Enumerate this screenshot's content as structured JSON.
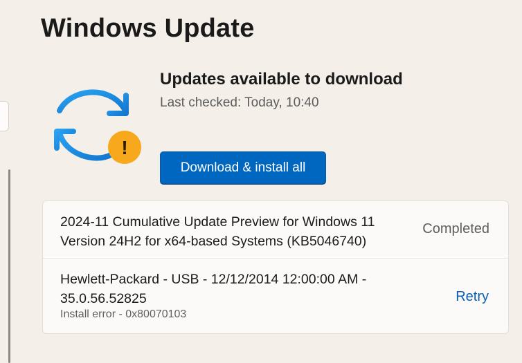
{
  "page": {
    "title": "Windows Update"
  },
  "status": {
    "title": "Updates available to download",
    "last_checked": "Last checked: Today, 10:40",
    "icon": "sync-warning-icon",
    "warning_glyph": "!"
  },
  "actions": {
    "download_install_all": "Download & install all"
  },
  "updates": [
    {
      "name": "2024-11 Cumulative Update Preview for Windows 11\nVersion 24H2 for x64-based Systems (KB5046740)",
      "status": "Completed"
    },
    {
      "name": "Hewlett-Packard - USB - 12/12/2014 12:00:00 AM -\n35.0.56.52825",
      "error": "Install error - 0x80070103",
      "action": "Retry"
    }
  ],
  "colors": {
    "accent": "#0067c0",
    "sync_icon": "#1a8ee0",
    "warning": "#f5a623",
    "background": "#f4f0e9",
    "card": "#fbfaf8",
    "link": "#0a5fb4"
  }
}
